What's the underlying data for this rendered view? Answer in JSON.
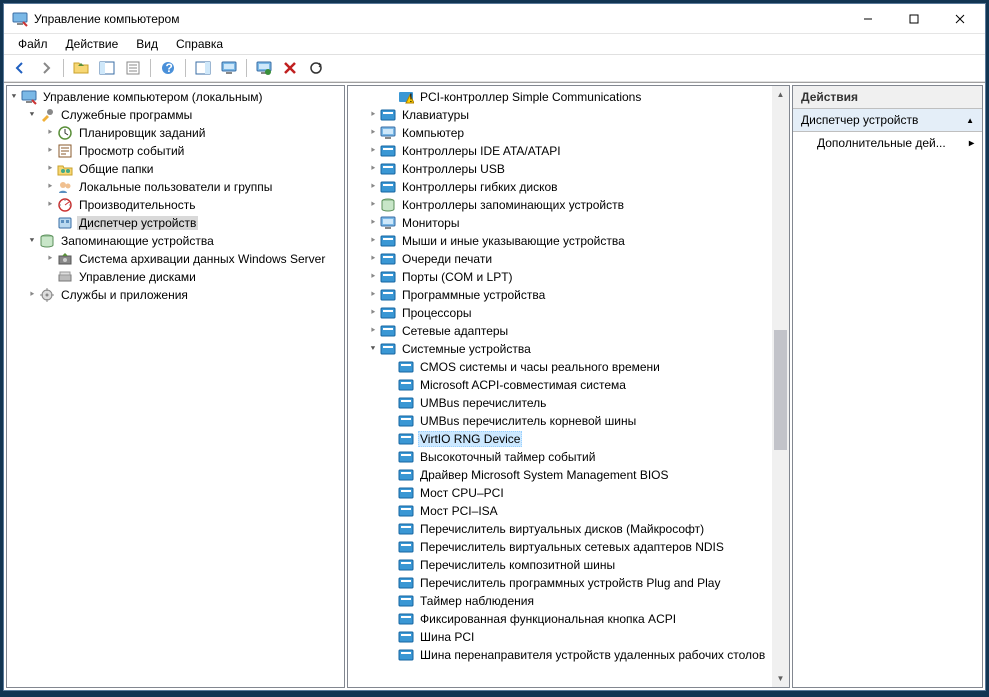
{
  "window": {
    "title": "Управление компьютером"
  },
  "menu": {
    "items": [
      "Файл",
      "Действие",
      "Вид",
      "Справка"
    ]
  },
  "toolbar_icons": [
    "back",
    "forward",
    "up",
    "panes",
    "list",
    "help",
    "panes2",
    "monitor",
    "monitor2",
    "deleteX",
    "refresh"
  ],
  "left_tree": {
    "root": "Управление компьютером (локальным)",
    "groups": [
      {
        "label": "Служебные программы",
        "expanded": true,
        "icon": "tools",
        "children": [
          {
            "label": "Планировщик заданий",
            "icon": "clock",
            "expandable": true
          },
          {
            "label": "Просмотр событий",
            "icon": "event",
            "expandable": true
          },
          {
            "label": "Общие папки",
            "icon": "share",
            "expandable": true
          },
          {
            "label": "Локальные пользователи и группы",
            "icon": "users",
            "expandable": true
          },
          {
            "label": "Производительность",
            "icon": "perf",
            "expandable": true
          },
          {
            "label": "Диспетчер устройств",
            "icon": "device",
            "expandable": false,
            "selected": true
          }
        ]
      },
      {
        "label": "Запоминающие устройства",
        "expanded": true,
        "icon": "storage",
        "children": [
          {
            "label": "Система архивации данных Windows Server",
            "icon": "backup",
            "expandable": true
          },
          {
            "label": "Управление дисками",
            "icon": "disk",
            "expandable": false
          }
        ]
      },
      {
        "label": "Службы и приложения",
        "expanded": false,
        "icon": "services",
        "children": []
      }
    ]
  },
  "center_tree": {
    "items": [
      {
        "indent": 2,
        "label": "PCI-контроллер Simple Communications",
        "icon": "warn",
        "tw": ""
      },
      {
        "indent": 1,
        "label": "Клавиатуры",
        "icon": "keyboard",
        "tw": "c"
      },
      {
        "indent": 1,
        "label": "Компьютер",
        "icon": "computer",
        "tw": "c"
      },
      {
        "indent": 1,
        "label": "Контроллеры IDE ATA/ATAPI",
        "icon": "ide",
        "tw": "c"
      },
      {
        "indent": 1,
        "label": "Контроллеры USB",
        "icon": "usb",
        "tw": "c"
      },
      {
        "indent": 1,
        "label": "Контроллеры гибких дисков",
        "icon": "floppy",
        "tw": "c"
      },
      {
        "indent": 1,
        "label": "Контроллеры запоминающих устройств",
        "icon": "storage",
        "tw": "c"
      },
      {
        "indent": 1,
        "label": "Мониторы",
        "icon": "monitor",
        "tw": "c"
      },
      {
        "indent": 1,
        "label": "Мыши и иные указывающие устройства",
        "icon": "mouse",
        "tw": "c"
      },
      {
        "indent": 1,
        "label": "Очереди печати",
        "icon": "print",
        "tw": "c"
      },
      {
        "indent": 1,
        "label": "Порты (COM и LPT)",
        "icon": "port",
        "tw": "c"
      },
      {
        "indent": 1,
        "label": "Программные устройства",
        "icon": "soft",
        "tw": "c"
      },
      {
        "indent": 1,
        "label": "Процессоры",
        "icon": "cpu",
        "tw": "c"
      },
      {
        "indent": 1,
        "label": "Сетевые адаптеры",
        "icon": "net",
        "tw": "c"
      },
      {
        "indent": 1,
        "label": "Системные устройства",
        "icon": "sys",
        "tw": "e"
      },
      {
        "indent": 2,
        "label": "CMOS системы и часы реального времени",
        "icon": "sys",
        "tw": ""
      },
      {
        "indent": 2,
        "label": "Microsoft ACPI-совместимая система",
        "icon": "sys",
        "tw": ""
      },
      {
        "indent": 2,
        "label": "UMBus перечислитель",
        "icon": "sys",
        "tw": ""
      },
      {
        "indent": 2,
        "label": "UMBus перечислитель корневой шины",
        "icon": "sys",
        "tw": ""
      },
      {
        "indent": 2,
        "label": "VirtIO RNG Device",
        "icon": "sys",
        "tw": "",
        "selected": true
      },
      {
        "indent": 2,
        "label": "Высокоточный таймер событий",
        "icon": "sys",
        "tw": ""
      },
      {
        "indent": 2,
        "label": "Драйвер Microsoft System Management BIOS",
        "icon": "sys",
        "tw": ""
      },
      {
        "indent": 2,
        "label": "Мост CPU–PCI",
        "icon": "sys",
        "tw": ""
      },
      {
        "indent": 2,
        "label": "Мост PCI–ISA",
        "icon": "sys",
        "tw": ""
      },
      {
        "indent": 2,
        "label": "Перечислитель виртуальных дисков (Майкрософт)",
        "icon": "sys",
        "tw": ""
      },
      {
        "indent": 2,
        "label": "Перечислитель виртуальных сетевых адаптеров NDIS",
        "icon": "sys",
        "tw": ""
      },
      {
        "indent": 2,
        "label": "Перечислитель композитной шины",
        "icon": "sys",
        "tw": ""
      },
      {
        "indent": 2,
        "label": "Перечислитель программных устройств Plug and Play",
        "icon": "sys",
        "tw": ""
      },
      {
        "indent": 2,
        "label": "Таймер наблюдения",
        "icon": "sys",
        "tw": ""
      },
      {
        "indent": 2,
        "label": "Фиксированная функциональная кнопка ACPI",
        "icon": "sys",
        "tw": ""
      },
      {
        "indent": 2,
        "label": "Шина PCI",
        "icon": "sys",
        "tw": ""
      },
      {
        "indent": 2,
        "label": "Шина перенаправителя устройств удаленных рабочих столов",
        "icon": "sys",
        "tw": ""
      }
    ]
  },
  "actions": {
    "header": "Действия",
    "section": "Диспетчер устройств",
    "item": "Дополнительные дей..."
  }
}
